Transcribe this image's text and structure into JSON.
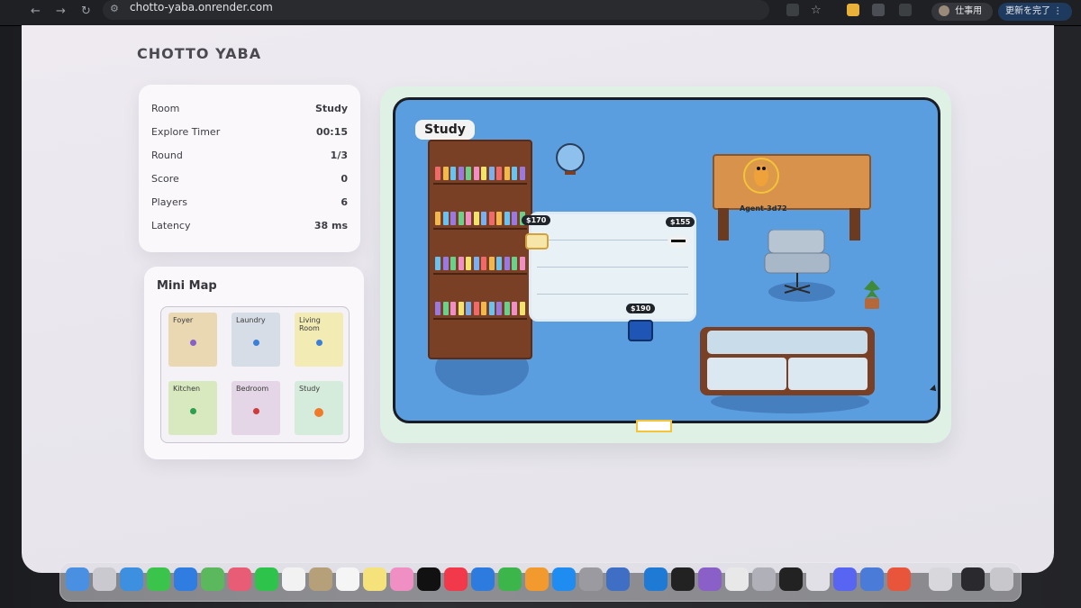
{
  "browser": {
    "url": "chotto-yaba.onrender.com",
    "profile_label": "仕事用",
    "update_label": "更新を完了"
  },
  "brand": "CHOTTO YABA",
  "stats": [
    {
      "key": "Room",
      "value": "Study"
    },
    {
      "key": "Explore Timer",
      "value": "00:15"
    },
    {
      "key": "Round",
      "value": "1/3"
    },
    {
      "key": "Score",
      "value": "0"
    },
    {
      "key": "Players",
      "value": "6"
    },
    {
      "key": "Latency",
      "value": "38 ms"
    }
  ],
  "minimap": {
    "title": "Mini Map",
    "rooms": [
      {
        "label": "Foyer",
        "fill": "#ead8b3",
        "dot": "#8a5fc7"
      },
      {
        "label": "Laundry",
        "fill": "#d7dde6",
        "dot": "#3b7fd8"
      },
      {
        "label": "Living Room",
        "fill": "#f2ebb4",
        "dot": "#3b7fd8"
      },
      {
        "label": "Kitchen",
        "fill": "#d8e8bf",
        "dot": "#2e9e4f"
      },
      {
        "label": "Bedroom",
        "fill": "#e4d6e6",
        "dot": "#cf3a3a"
      },
      {
        "label": "Study",
        "fill": "#d5ecdc",
        "dot": "#f07a2a"
      }
    ]
  },
  "game": {
    "room_label": "Study",
    "prices": [
      "$170",
      "$155",
      "$190"
    ],
    "agent_name": "Agent-3d72"
  },
  "colors": {
    "floor": "#5b9ee0",
    "wood": "#7a4026",
    "desk": "#d8924c",
    "accent": "#f3c43a"
  }
}
